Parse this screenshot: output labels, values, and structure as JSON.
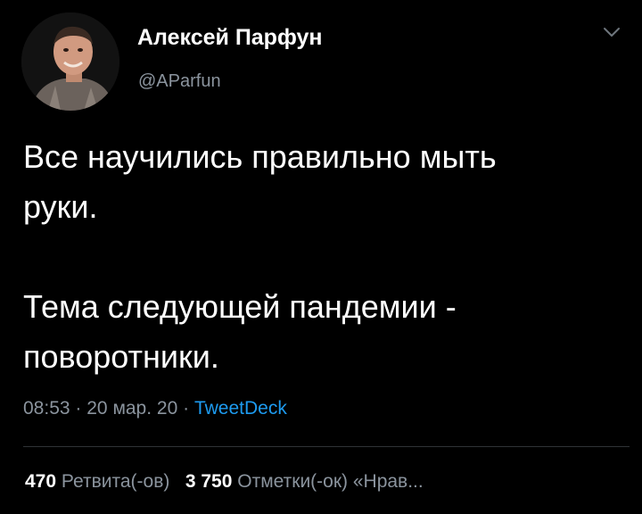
{
  "author": {
    "name": "Алексей Парфун",
    "handle": "@AParfun"
  },
  "tweet": {
    "lines": [
      "Все научились правильно мыть",
      "руки.",
      "Тема следующей пандемии -",
      "поворотники."
    ]
  },
  "meta": {
    "time": "08:53",
    "sep1": "·",
    "date": "20 мар. 20",
    "sep2": "·",
    "source": "TweetDeck"
  },
  "stats": {
    "retweets_count": "470",
    "retweets_label": "Ретвита(-ов)",
    "likes_count": "3 750",
    "likes_label": "Отметки(-ок) «Нрав..."
  },
  "icons": {
    "more": "chevron-down-icon"
  },
  "colors": {
    "background": "#000000",
    "text": "#ffffff",
    "secondary": "#8b949e",
    "link": "#1d9bf0"
  }
}
